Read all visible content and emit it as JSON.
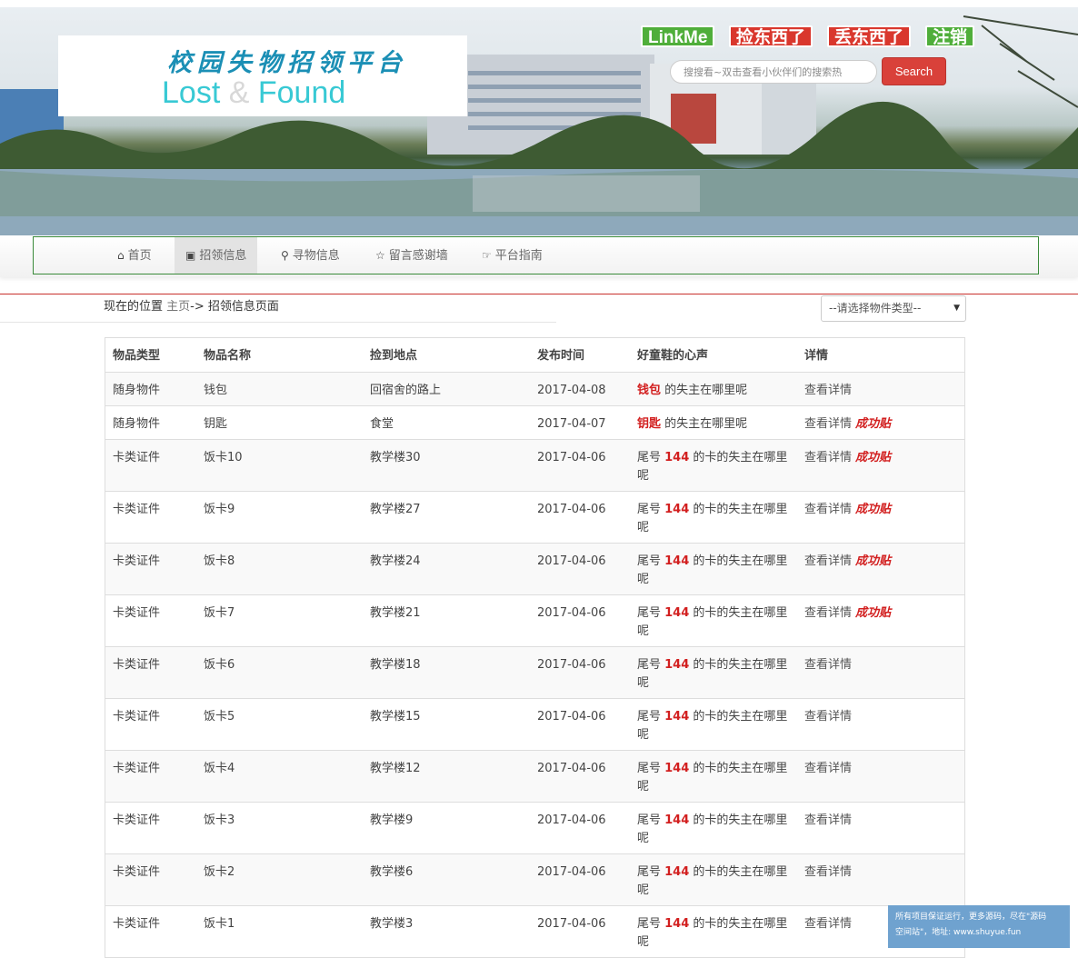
{
  "logo": {
    "cn": "校园失物招领平台",
    "en_left": "Lost",
    "en_amp": "&",
    "en_right": "Found"
  },
  "top_buttons": {
    "linkme": "LinkMe",
    "pick": "捡东西了",
    "lose": "丢东西了",
    "logout": "注销"
  },
  "search": {
    "placeholder": "搜搜看~双击查看小伙伴们的搜索热",
    "button": "Search"
  },
  "nav": [
    {
      "label": "首页",
      "icon": "home-icon"
    },
    {
      "label": "招领信息",
      "icon": "picture-icon"
    },
    {
      "label": "寻物信息",
      "icon": "zoom-icon"
    },
    {
      "label": "留言感谢墙",
      "icon": "star-icon"
    },
    {
      "label": "平台指南",
      "icon": "hand-pointer-icon"
    }
  ],
  "breadcrumb": {
    "prefix": "现在的位置",
    "home": "主页",
    "sep": "->",
    "current": "招领信息页面"
  },
  "type_select": {
    "selected": "--请选择物件类型--"
  },
  "table": {
    "headers": [
      "物品类型",
      "物品名称",
      "捡到地点",
      "发布时间",
      "好童鞋的心声",
      "详情"
    ],
    "detail_label": "查看详情",
    "success_label": "成功贴",
    "rows": [
      {
        "type": "随身物件",
        "name": "钱包",
        "place": "回宿舍的路上",
        "date": "2017-04-08",
        "hl": "钱包",
        "msg": " 的失主在哪里呢",
        "success": false
      },
      {
        "type": "随身物件",
        "name": "钥匙",
        "place": "食堂",
        "date": "2017-04-07",
        "hl": "钥匙",
        "msg": " 的失主在哪里呢",
        "success": true
      },
      {
        "type": "卡类证件",
        "name": "饭卡10",
        "place": "教学楼30",
        "date": "2017-04-06",
        "pre": "尾号 ",
        "hl": "144",
        "msg": " 的卡的失主在哪里呢",
        "success": true
      },
      {
        "type": "卡类证件",
        "name": "饭卡9",
        "place": "教学楼27",
        "date": "2017-04-06",
        "pre": "尾号 ",
        "hl": "144",
        "msg": " 的卡的失主在哪里呢",
        "success": true
      },
      {
        "type": "卡类证件",
        "name": "饭卡8",
        "place": "教学楼24",
        "date": "2017-04-06",
        "pre": "尾号 ",
        "hl": "144",
        "msg": " 的卡的失主在哪里呢",
        "success": true
      },
      {
        "type": "卡类证件",
        "name": "饭卡7",
        "place": "教学楼21",
        "date": "2017-04-06",
        "pre": "尾号 ",
        "hl": "144",
        "msg": " 的卡的失主在哪里呢",
        "success": true
      },
      {
        "type": "卡类证件",
        "name": "饭卡6",
        "place": "教学楼18",
        "date": "2017-04-06",
        "pre": "尾号 ",
        "hl": "144",
        "msg": " 的卡的失主在哪里呢",
        "success": false
      },
      {
        "type": "卡类证件",
        "name": "饭卡5",
        "place": "教学楼15",
        "date": "2017-04-06",
        "pre": "尾号 ",
        "hl": "144",
        "msg": " 的卡的失主在哪里呢",
        "success": false
      },
      {
        "type": "卡类证件",
        "name": "饭卡4",
        "place": "教学楼12",
        "date": "2017-04-06",
        "pre": "尾号 ",
        "hl": "144",
        "msg": " 的卡的失主在哪里呢",
        "success": false
      },
      {
        "type": "卡类证件",
        "name": "饭卡3",
        "place": "教学楼9",
        "date": "2017-04-06",
        "pre": "尾号 ",
        "hl": "144",
        "msg": " 的卡的失主在哪里呢",
        "success": false
      },
      {
        "type": "卡类证件",
        "name": "饭卡2",
        "place": "教学楼6",
        "date": "2017-04-06",
        "pre": "尾号 ",
        "hl": "144",
        "msg": " 的卡的失主在哪里呢",
        "success": false
      },
      {
        "type": "卡类证件",
        "name": "饭卡1",
        "place": "教学楼3",
        "date": "2017-04-06",
        "pre": "尾号 ",
        "hl": "144",
        "msg": " 的卡的失主在哪里呢",
        "success": false
      }
    ]
  },
  "notice": {
    "line1": "所有项目保证运行，更多源码，尽在\"源码",
    "line2": "空间站\"，地址: www.shuyue.fun"
  },
  "colors": {
    "accent_red": "#d21f1f",
    "nav_border": "#3a8a3a",
    "btn_green": "#4fae3a",
    "btn_red": "#d9372d"
  }
}
